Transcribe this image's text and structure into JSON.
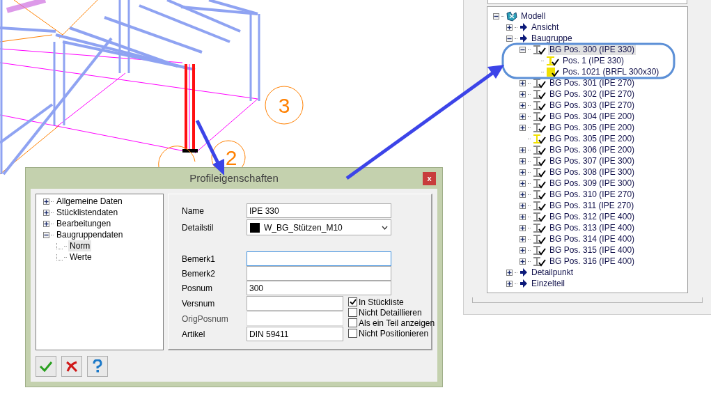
{
  "drawing": {
    "grid_labels": [
      "3",
      "2"
    ]
  },
  "model_tree": [
    {
      "label": "Modell",
      "kind": "model",
      "expanded": true,
      "selected": false,
      "children": [
        {
          "label": "Ansicht",
          "kind": "folder",
          "expanded": false,
          "selected": false
        },
        {
          "label": "Baugruppe",
          "kind": "folder",
          "expanded": true,
          "selected": false,
          "children": [
            {
              "label": "BG Pos. 300 (IPE 330)",
              "kind": "assembly",
              "expanded": true,
              "selected": true,
              "children": [
                {
                  "label": "Pos. 1 (IPE 330)",
                  "kind": "beam",
                  "selected": false
                },
                {
                  "label": "Pos. 1021 (BRFL 300x30)",
                  "kind": "plate",
                  "selected": false
                }
              ]
            },
            {
              "label": "BG Pos. 301 (IPE 270)",
              "kind": "assembly",
              "expanded": false,
              "selected": false
            },
            {
              "label": "BG Pos. 302 (IPE 270)",
              "kind": "assembly",
              "expanded": false,
              "selected": false
            },
            {
              "label": "BG Pos. 303 (IPE 270)",
              "kind": "assembly",
              "expanded": false,
              "selected": false
            },
            {
              "label": "BG Pos. 304 (IPE 200)",
              "kind": "assembly",
              "expanded": false,
              "selected": false
            },
            {
              "label": "BG Pos. 305 (IPE 200)",
              "kind": "assembly",
              "expanded": false,
              "selected": false
            },
            {
              "label": "BG Pos. 305 (IPE 200)",
              "kind": "beam-assembly",
              "selected": false
            },
            {
              "label": "BG Pos. 306 (IPE 200)",
              "kind": "assembly",
              "expanded": false,
              "selected": false
            },
            {
              "label": "BG Pos. 307 (IPE 300)",
              "kind": "assembly",
              "expanded": false,
              "selected": false
            },
            {
              "label": "BG Pos. 308 (IPE 300)",
              "kind": "assembly",
              "expanded": false,
              "selected": false
            },
            {
              "label": "BG Pos. 309 (IPE 300)",
              "kind": "assembly",
              "expanded": false,
              "selected": false
            },
            {
              "label": "BG Pos. 310 (IPE 270)",
              "kind": "assembly",
              "expanded": false,
              "selected": false
            },
            {
              "label": "BG Pos. 311 (IPE 270)",
              "kind": "assembly",
              "expanded": false,
              "selected": false
            },
            {
              "label": "BG Pos. 312 (IPE 400)",
              "kind": "assembly",
              "expanded": false,
              "selected": false
            },
            {
              "label": "BG Pos. 313 (IPE 400)",
              "kind": "assembly",
              "expanded": false,
              "selected": false
            },
            {
              "label": "BG Pos. 314 (IPE 400)",
              "kind": "assembly",
              "expanded": false,
              "selected": false
            },
            {
              "label": "BG Pos. 315 (IPE 400)",
              "kind": "assembly",
              "expanded": false,
              "selected": false
            },
            {
              "label": "BG Pos. 316 (IPE 400)",
              "kind": "assembly",
              "expanded": false,
              "selected": false
            }
          ]
        },
        {
          "label": "Detailpunkt",
          "kind": "folder",
          "expanded": false,
          "selected": false
        },
        {
          "label": "Einzelteil",
          "kind": "folder",
          "expanded": false,
          "selected": false
        }
      ]
    }
  ],
  "dialog": {
    "title": "Profileigenschaften",
    "close": "x",
    "tree": [
      {
        "label": "Allgemeine Daten",
        "expanded": false,
        "selected": false
      },
      {
        "label": "Stücklistendaten",
        "expanded": false,
        "selected": false
      },
      {
        "label": "Bearbeitungen",
        "expanded": false,
        "selected": false
      },
      {
        "label": "Baugruppendaten",
        "expanded": true,
        "selected": false,
        "children": [
          {
            "label": "Norm",
            "selected": true
          },
          {
            "label": "Werte",
            "selected": false
          }
        ]
      }
    ],
    "fields_top": [
      {
        "label": "Name",
        "kind": "text",
        "value": "IPE 330"
      },
      {
        "label": "Detailstil",
        "kind": "select",
        "value": "W_BG_Stützen_M10"
      }
    ],
    "fields_middle": [
      {
        "label": "Bemerk1",
        "focused": true
      },
      {
        "label": "Bemerk2",
        "focused": false
      },
      {
        "label": "Posnum",
        "value": "300",
        "focused": false
      }
    ],
    "fields_bottom": [
      {
        "label": "Versnum",
        "disabled": false
      },
      {
        "label": "OrigPosnum",
        "disabled": true
      },
      {
        "label": "Artikel",
        "value": "DIN 59411",
        "disabled": false
      }
    ],
    "checkboxes": [
      {
        "label": "In Stückliste",
        "checked": true
      },
      {
        "label": "Nicht Detaillieren",
        "checked": false
      },
      {
        "label": "Als ein Teil anzeigen",
        "checked": false
      },
      {
        "label": "Nicht Positionieren",
        "checked": false
      }
    ],
    "buttons": [
      {
        "kind": "ok"
      },
      {
        "kind": "cancel"
      },
      {
        "kind": "help"
      }
    ]
  }
}
